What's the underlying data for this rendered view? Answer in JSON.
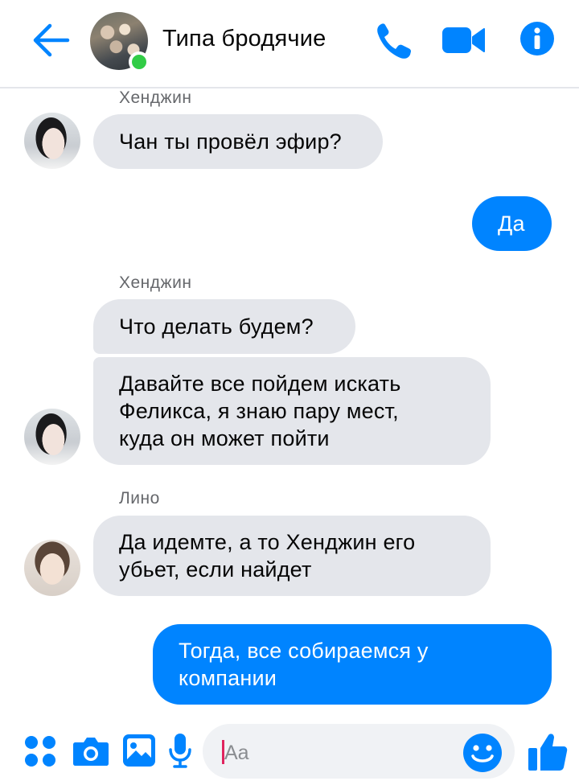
{
  "header": {
    "title": "Типа бродячие",
    "online": true
  },
  "messages": [
    {
      "sender": "Хенджин",
      "text": "Чан ты провёл эфир?",
      "direction": "incoming"
    },
    {
      "text": "Да",
      "direction": "outgoing"
    },
    {
      "sender": "Хенджин",
      "text": "Что делать будем?",
      "direction": "incoming"
    },
    {
      "lines": [
        "Давайте все пойдем искать",
        "Феликса, я знаю пару мест,",
        "куда он может пойти"
      ],
      "direction": "incoming"
    },
    {
      "sender": "Лино",
      "lines": [
        "Да идемте, а то Хенджин его",
        "убьет, если найдет"
      ],
      "direction": "incoming"
    },
    {
      "lines": [
        "Тогда, все собираемся у",
        "компании"
      ],
      "direction": "outgoing"
    }
  ],
  "composer": {
    "placeholder": "Aa"
  },
  "icons": {
    "back": "arrow-left-icon",
    "call": "phone-icon",
    "video": "video-camera-icon",
    "info": "info-icon",
    "more": "four-dots-icon",
    "camera": "camera-icon",
    "gallery": "image-icon",
    "mic": "microphone-icon",
    "emoji": "emoji-icon",
    "like": "thumbs-up-icon"
  },
  "colors": {
    "accent": "#0084ff",
    "incoming_bubble": "#e4e6eb",
    "online": "#31cc46"
  }
}
